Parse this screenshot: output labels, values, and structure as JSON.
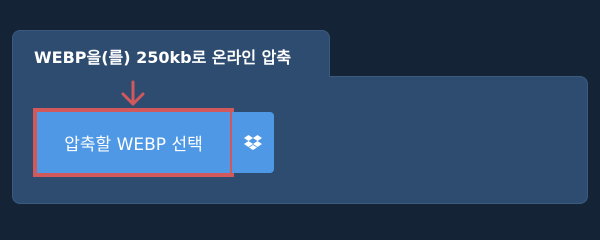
{
  "panel": {
    "title": "WEBP을(를) 250kb로 온라인 압축"
  },
  "upload": {
    "button_label": "압축할 WEBP 선택"
  },
  "icons": {
    "arrow": "arrow-down-icon",
    "dropbox": "dropbox-icon"
  },
  "colors": {
    "background": "#152336",
    "panel": "#2e4c70",
    "button": "#4e98e6",
    "highlight": "#d1585b"
  }
}
